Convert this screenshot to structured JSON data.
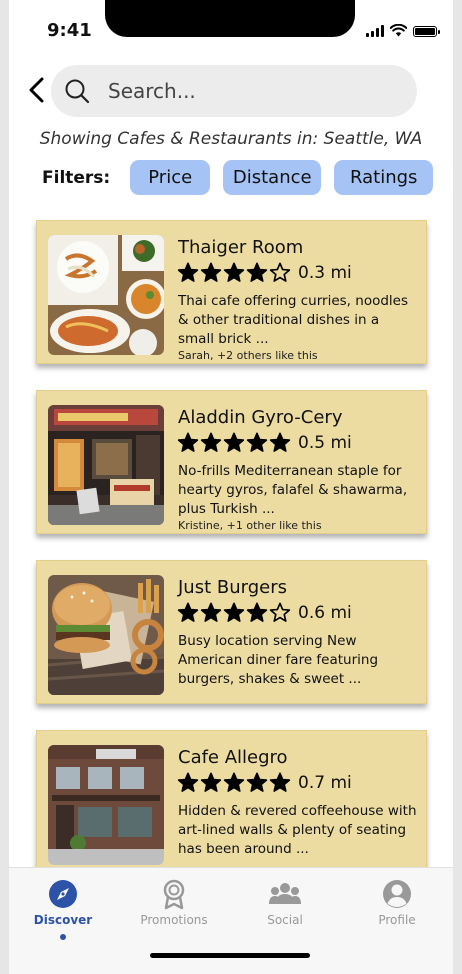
{
  "status": {
    "time": "9:41"
  },
  "search": {
    "placeholder": "Search..."
  },
  "location_text": "Showing Cafes & Restaurants in: Seattle, WA",
  "filters": {
    "label": "Filters:",
    "buttons": [
      "Price",
      "Distance",
      "Ratings"
    ]
  },
  "results": [
    {
      "name": "Thaiger Room",
      "rating": 4,
      "max_rating": 5,
      "distance": "0.3 mi",
      "description": "Thai cafe offering curries, noodles & other traditional dishes in a small brick ...",
      "likes": "Sarah, +2 others like this",
      "image": "food-platter"
    },
    {
      "name": "Aladdin Gyro-Cery",
      "rating": 5,
      "max_rating": 5,
      "distance": "0.5 mi",
      "description": "No-frills Mediterranean staple for hearty gyros, falafel & shawarma, plus Turkish ...",
      "likes": "Kristine, +1 other like this",
      "image": "storefront"
    },
    {
      "name": "Just Burgers",
      "rating": 4,
      "max_rating": 5,
      "distance": "0.6 mi",
      "description": "Busy location serving New American diner fare featuring burgers, shakes & sweet ...",
      "likes": "",
      "image": "burger"
    },
    {
      "name": "Cafe Allegro",
      "rating": 5,
      "max_rating": 5,
      "distance": "0.7 mi",
      "description": "Hidden & revered coffeehouse with art-lined walls & plenty of seating has been around ...",
      "likes": "",
      "image": "brick-building"
    }
  ],
  "nav": {
    "items": [
      {
        "label": "Discover",
        "icon": "compass-icon",
        "active": true
      },
      {
        "label": "Promotions",
        "icon": "ribbon-icon",
        "active": false
      },
      {
        "label": "Social",
        "icon": "group-icon",
        "active": false
      },
      {
        "label": "Profile",
        "icon": "user-icon",
        "active": false
      }
    ]
  },
  "colors": {
    "card_bg": "#ecdca2",
    "filter_bg": "#a5c3f4",
    "nav_active": "#2d53a8",
    "nav_inactive": "#999999"
  }
}
